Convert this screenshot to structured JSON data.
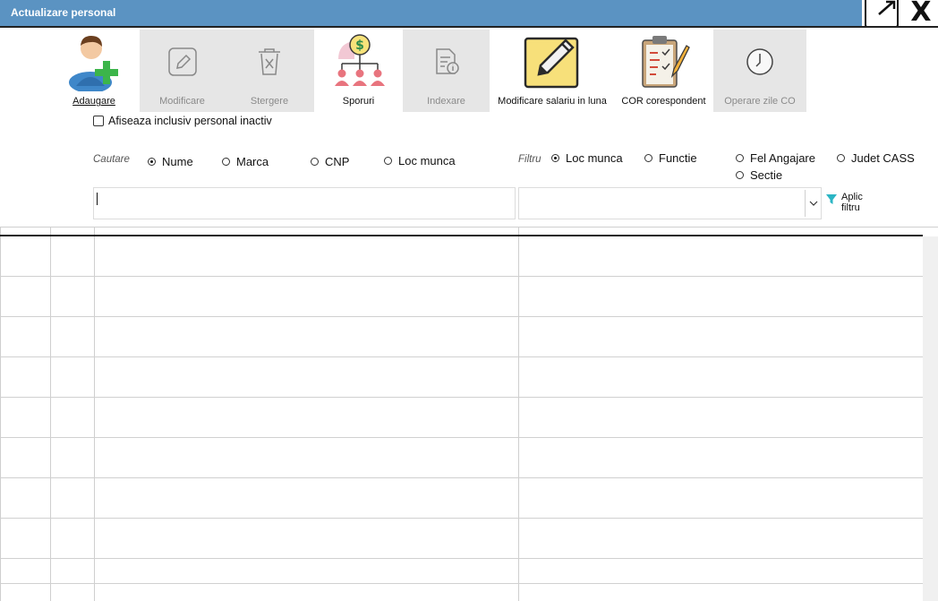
{
  "window": {
    "title": "Actualizare personal",
    "expand_icon": "expand-icon",
    "close_label": "X"
  },
  "toolbar": {
    "items": [
      {
        "label": "Adaugare",
        "icon": "add-person-icon",
        "enabled": true
      },
      {
        "label": "Modificare",
        "icon": "edit-icon",
        "enabled": false
      },
      {
        "label": "Stergere",
        "icon": "delete-icon",
        "enabled": false
      },
      {
        "label": "Sporuri",
        "icon": "bonus-hierarchy-icon",
        "enabled": true
      },
      {
        "label": "Indexare",
        "icon": "index-document-icon",
        "enabled": false
      },
      {
        "label": "Modificare salariu in luna",
        "icon": "pencil-note-icon",
        "enabled": true
      },
      {
        "label": "COR corespondent",
        "icon": "clipboard-icon",
        "enabled": true
      },
      {
        "label": "Operare zile CO",
        "icon": "clock-icon",
        "enabled": false
      }
    ]
  },
  "inactive_checkbox": {
    "label": "Afiseaza inclusiv personal inactiv",
    "checked": false
  },
  "search": {
    "label": "Cautare",
    "options": [
      {
        "label": "Nume",
        "selected": true
      },
      {
        "label": "Marca",
        "selected": false
      },
      {
        "label": "CNP",
        "selected": false
      },
      {
        "label": "Loc munca",
        "selected": false
      }
    ],
    "value": ""
  },
  "filter": {
    "label": "Filtru",
    "options": [
      {
        "label": "Loc munca",
        "selected": true
      },
      {
        "label": "Functie",
        "selected": false
      },
      {
        "label": "Fel Angajare",
        "selected": false
      },
      {
        "label": "Judet CASS",
        "selected": false
      },
      {
        "label": "Sectie",
        "selected": false
      }
    ],
    "selected_value": "",
    "apply_line1": "Aplic",
    "apply_line2": "filtru"
  },
  "colors": {
    "titlebar": "#5b93c2",
    "disabled_tool_bg": "#e6e6e6",
    "filter_icon": "#2bb5c4"
  }
}
